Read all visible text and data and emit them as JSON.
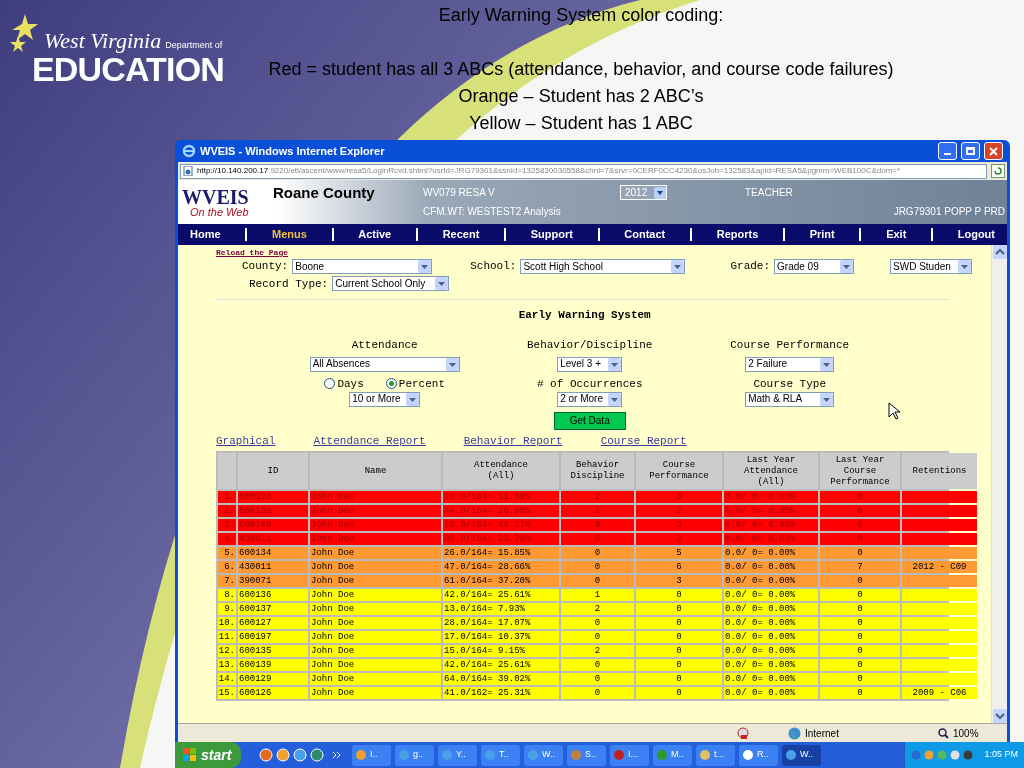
{
  "slide": {
    "title": "Early Warning System color coding:",
    "legend": [
      "Red = student has all 3 ABCs (attendance, behavior, and course code failures)",
      "Orange – Student has 2 ABC’s",
      "Yellow – Student has 1 ABC"
    ],
    "logo": {
      "line1": "West Virginia",
      "line2": "Department of",
      "line3": "EDUCATION"
    }
  },
  "window": {
    "title": "WVEIS - Windows Internet Explorer",
    "address_host": "http://10.140.200.17",
    "address_rest": ":9220/etl/ascent/www/resa5/LoginRcvd.shtml?usrId=JRG79301&ssnId=1325830030558&chnl=7&srvr=0CERF0CC4230&osJob=132583&apid=RESA5&pgmm=WEB100C&dom=*"
  },
  "header": {
    "logo": "WVEIS",
    "logo_sub": "On the Web",
    "county": "Roane County",
    "resa": "WV079 RESA V",
    "year": "2012",
    "role": "TEACHER",
    "analysis": "CFM.WT: WESTEST2 Analysis",
    "user": "JRG79301 POPP P PRD"
  },
  "nav": [
    {
      "label": "Home",
      "selected": false
    },
    {
      "label": "Menus",
      "selected": true
    },
    {
      "label": "Active",
      "selected": false
    },
    {
      "label": "Recent",
      "selected": false
    },
    {
      "label": "Support",
      "selected": false
    },
    {
      "label": "Contact",
      "selected": false
    },
    {
      "label": "Reports",
      "selected": false
    },
    {
      "label": "Print",
      "selected": false
    },
    {
      "label": "Exit",
      "selected": false
    },
    {
      "label": "Logout",
      "selected": false
    }
  ],
  "filters": {
    "reload": "Reload the Page",
    "fields": [
      {
        "label": "County:",
        "value": "Boone"
      },
      {
        "label": "School:",
        "value": "Scott High School"
      },
      {
        "label": "Grade:",
        "value": "Grade 09"
      },
      {
        "value": "SWD Studen"
      }
    ],
    "record_type": {
      "label": "Record Type:",
      "value": "Current School Only"
    }
  },
  "ews": {
    "title": "Early Warning System",
    "attendance": {
      "heading": "Attendance",
      "select": "All Absences",
      "radios": [
        {
          "label": "Days",
          "selected": false
        },
        {
          "label": "Percent",
          "selected": true
        }
      ],
      "threshold": "10 or More"
    },
    "behavior": {
      "heading": "Behavior/Discipline",
      "select": "Level 3 +",
      "sub": "# of Occurrences",
      "value": "2 or More"
    },
    "course": {
      "heading": "Course Performance",
      "select": "2 Failure",
      "sub": "Course Type",
      "value": "Math & RLA"
    },
    "button": "Get Data"
  },
  "links": [
    "Graphical",
    "Attendance Report",
    "Behavior Report",
    "Course Report"
  ],
  "table": {
    "columns": [
      "ID",
      "Name",
      "Attendance\n(All)",
      "Behavior\nDiscipline",
      "Course\nPerformance",
      "Last Year\nAttendance\n(All)",
      "Last Year\nCourse\nPerformance",
      "Retentions"
    ],
    "rows": [
      {
        "num": "1.",
        "id": "600128",
        "name": "John Doe",
        "att": "19.0/164= 11.59%",
        "beh": "2",
        "course": "3",
        "ly_att": "0.0/ 0= 0.00%",
        "ly_course": "0",
        "ret": "",
        "color": "#ff0000"
      },
      {
        "num": "2.",
        "id": "600138",
        "name": "John Doe",
        "att": "44.0/164= 26.83%",
        "beh": "2",
        "course": "2",
        "ly_att": "0.0/ 5= 0.00%",
        "ly_course": "0",
        "ret": "",
        "color": "#ff0000"
      },
      {
        "num": "3.",
        "id": "600149",
        "name": "John Doe",
        "att": "79.0/164= 48.17%",
        "beh": "4",
        "course": "3",
        "ly_att": "0.0/ 0= 0.00%",
        "ly_course": "0",
        "ret": "",
        "color": "#ff0000"
      },
      {
        "num": "4.",
        "id": "430011",
        "name": "John Doe",
        "att": "39.0/164= 23.78%",
        "beh": "5",
        "course": "2",
        "ly_att": "0.0/ 0= 0.00%",
        "ly_course": "0",
        "ret": "",
        "color": "#ff0000"
      },
      {
        "num": "5.",
        "id": "600134",
        "name": "John Doe",
        "att": "26.0/164= 15.85%",
        "beh": "0",
        "course": "5",
        "ly_att": "0.0/ 0= 0.00%",
        "ly_course": "0",
        "ret": "",
        "color": "#ff9933"
      },
      {
        "num": "6.",
        "id": "430011",
        "name": "John Doe",
        "att": "47.0/164= 28.66%",
        "beh": "0",
        "course": "6",
        "ly_att": "0.0/ 0= 0.00%",
        "ly_course": "7",
        "ret": "2012 - C09",
        "color": "#ff9933"
      },
      {
        "num": "7.",
        "id": "390071",
        "name": "John Doe",
        "att": "61.0/164= 37.20%",
        "beh": "0",
        "course": "3",
        "ly_att": "0.0/ 0= 0.00%",
        "ly_course": "0",
        "ret": "",
        "color": "#ff9933"
      },
      {
        "num": "8.",
        "id": "600136",
        "name": "John Doe",
        "att": "42.0/164= 25.61%",
        "beh": "1",
        "course": "0",
        "ly_att": "0.0/ 0= 0.00%",
        "ly_course": "0",
        "ret": "",
        "color": "#ffff00"
      },
      {
        "num": "9.",
        "id": "600137",
        "name": "John Doe",
        "att": "13.0/164= 7.93%",
        "beh": "2",
        "course": "0",
        "ly_att": "0.0/ 0= 0.00%",
        "ly_course": "0",
        "ret": "",
        "color": "#ffff00"
      },
      {
        "num": "10.",
        "id": "600127",
        "name": "John Doe",
        "att": "28.0/164= 17.07%",
        "beh": "0",
        "course": "0",
        "ly_att": "0.0/ 0= 0.00%",
        "ly_course": "0",
        "ret": "",
        "color": "#ffff00"
      },
      {
        "num": "11.",
        "id": "600197",
        "name": "John Doe",
        "att": "17.0/164= 10.37%",
        "beh": "0",
        "course": "0",
        "ly_att": "0.0/ 0= 0.00%",
        "ly_course": "0",
        "ret": "",
        "color": "#ffff00"
      },
      {
        "num": "12.",
        "id": "600135",
        "name": "John Doe",
        "att": "15.0/164= 9.15%",
        "beh": "2",
        "course": "0",
        "ly_att": "0.0/ 0= 0.00%",
        "ly_course": "0",
        "ret": "",
        "color": "#ffff00"
      },
      {
        "num": "13.",
        "id": "600139",
        "name": "John Doe",
        "att": "42.0/164= 25.61%",
        "beh": "0",
        "course": "0",
        "ly_att": "0.0/ 0= 0.00%",
        "ly_course": "0",
        "ret": "",
        "color": "#ffff00"
      },
      {
        "num": "14.",
        "id": "600129",
        "name": "John Doe",
        "att": "64.0/164= 39.02%",
        "beh": "0",
        "course": "0",
        "ly_att": "0.0/ 0= 0.00%",
        "ly_course": "0",
        "ret": "",
        "color": "#ffff00"
      },
      {
        "num": "15.",
        "id": "600126",
        "name": "John Doe",
        "att": "41.0/162= 25.31%",
        "beh": "0",
        "course": "0",
        "ly_att": "0.0/ 0= 0.00%",
        "ly_course": "0",
        "ret": "2009 - C06",
        "color": "#ffff00"
      }
    ]
  },
  "status_bar": {
    "zone": "Internet",
    "zoom": "100%"
  },
  "taskbar": {
    "start": "start",
    "buttons": [
      {
        "label": "I..",
        "selected": false
      },
      {
        "label": "g..",
        "selected": false
      },
      {
        "label": "Y..",
        "selected": false
      },
      {
        "label": "T..",
        "selected": false
      },
      {
        "label": "W..",
        "selected": false
      },
      {
        "label": "S..",
        "selected": false
      },
      {
        "label": "I...",
        "selected": false
      },
      {
        "label": "M..",
        "selected": false
      },
      {
        "label": "t...",
        "selected": false
      },
      {
        "label": "R..",
        "selected": false
      },
      {
        "label": "W..",
        "selected": true
      }
    ],
    "clock": "1:05 PM"
  }
}
